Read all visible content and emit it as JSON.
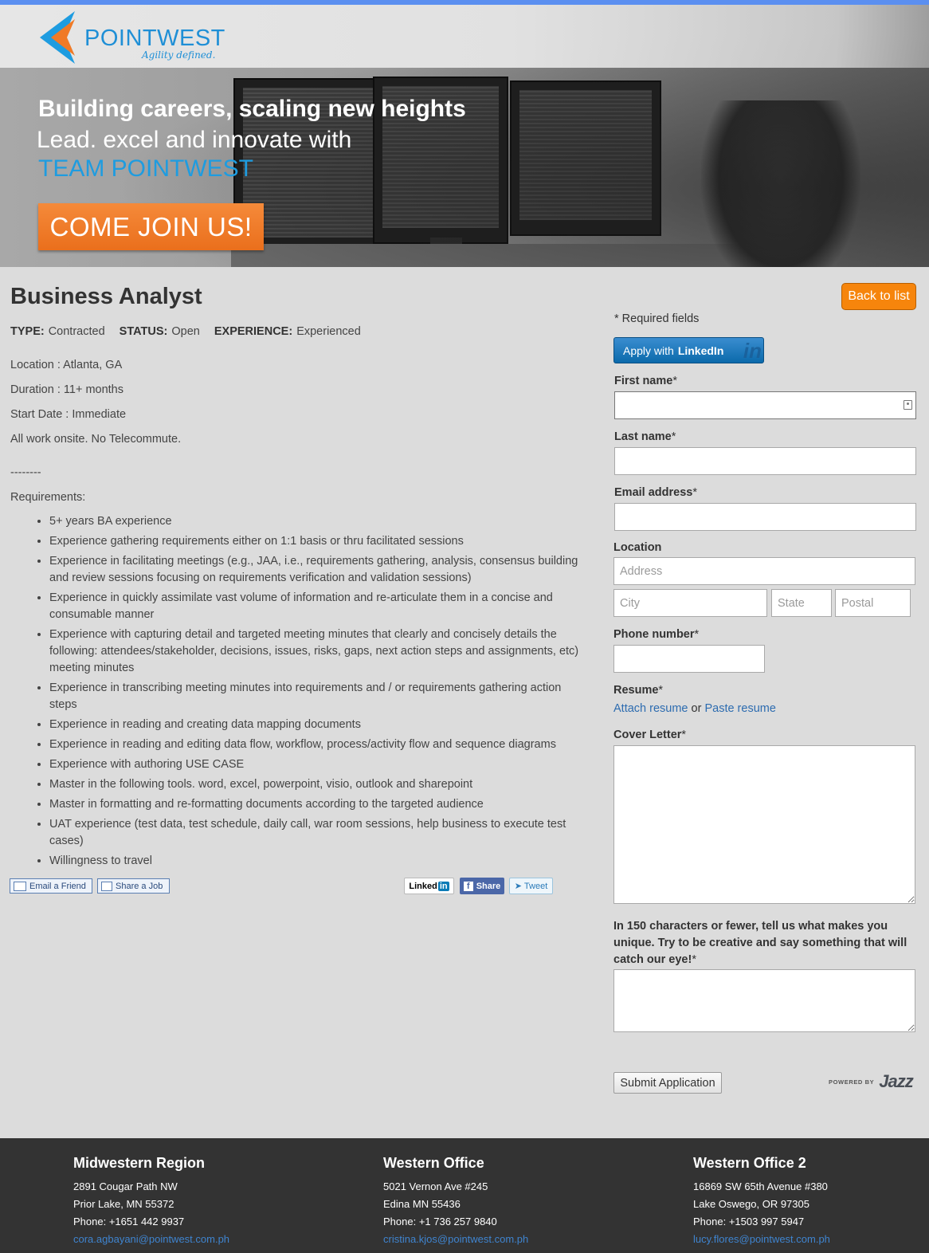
{
  "brand": {
    "name": "POINTWEST",
    "tagline": "Agility defined.",
    "colors": {
      "accent_blue": "#1e9ce0",
      "cta_orange": "#f6850c",
      "top_bar": "#5b8ff0",
      "footer_bg": "#333333"
    }
  },
  "hero": {
    "line1": "Building careers, scaling new heights",
    "line2": "Lead. excel and innovate with",
    "line3": "TEAM POINTWEST",
    "cta": "COME JOIN US!"
  },
  "job": {
    "title": "Business Analyst",
    "meta": {
      "type_label": "TYPE:",
      "type": "Contracted",
      "status_label": "STATUS:",
      "status": "Open",
      "experience_label": "EXPERIENCE:",
      "experience": "Experienced"
    },
    "details": {
      "location": "Location : Atlanta, GA",
      "duration": "Duration : 11+ months",
      "start_date": "Start Date : Immediate",
      "onsite": "All work onsite. No Telecommute.",
      "divider": "--------",
      "requirements_heading": "Requirements:"
    },
    "requirements": [
      "5+ years BA experience",
      "Experience gathering requirements either on 1:1 basis or thru facilitated sessions",
      "Experience in facilitating meetings (e.g., JAA, i.e., requirements gathering, analysis, consensus building and review sessions focusing on requirements verification and validation sessions)",
      "Experience in quickly assimilate vast volume of information and re-articulate them in a concise and consumable manner",
      "Experience with capturing detail and targeted meeting minutes that clearly and concisely details the following: attendees/stakeholder, decisions, issues, risks, gaps, next action steps and assignments, etc) meeting minutes",
      "Experience in transcribing meeting minutes into requirements and / or requirements gathering action steps",
      "Experience in reading and creating data mapping documents",
      "Experience in reading and editing data flow, workflow, process/activity flow and sequence diagrams",
      "Experience with authoring USE CASE",
      "Master in the following tools.  word, excel, powerpoint, visio, outlook and sharepoint",
      "Master in formatting and re-formatting documents according to the targeted audience",
      "UAT experience (test data, test schedule, daily call, war room sessions, help business to execute test cases)",
      "Willingness to travel"
    ]
  },
  "share": {
    "email_friend": "Email a Friend",
    "share_job": "Share a Job",
    "linkedin": "Linked",
    "linkedin_in": "in",
    "facebook": "Share",
    "twitter": "Tweet"
  },
  "form": {
    "back_to_list": "Back to list",
    "required_note": "* Required fields",
    "linkedin_apply_prefix": "Apply with ",
    "linkedin_apply_brand": "LinkedIn",
    "linkedin_badge": "in",
    "required_mark": "*",
    "first_name_label": "First name",
    "last_name_label": "Last name",
    "email_label": "Email address",
    "location_label": "Location",
    "address_placeholder": "Address",
    "city_placeholder": "City",
    "state_placeholder": "State",
    "postal_placeholder": "Postal",
    "phone_label": "Phone number",
    "resume_label": "Resume",
    "attach_resume": "Attach resume",
    "or": " or ",
    "paste_resume": "Paste resume",
    "cover_letter_label": "Cover Letter",
    "unique_label": "In 150 characters or fewer, tell us what makes you unique. Try to be creative and say something that will catch our eye!",
    "submit": "Submit Application",
    "powered_by": "POWERED BY",
    "jazz": "Jazz"
  },
  "footer": {
    "offices": [
      {
        "title": "Midwestern Region",
        "address1": "2891 Cougar Path NW",
        "address2": "Prior Lake, MN 55372",
        "phone": "Phone: +1651 442 9937",
        "email": "cora.agbayani@pointwest.com.ph"
      },
      {
        "title": "Western Office",
        "address1": "5021 Vernon Ave #245",
        "address2": "Edina MN 55436",
        "phone": "Phone: +1 736 257 9840",
        "email": "cristina.kjos@pointwest.com.ph"
      },
      {
        "title": "Western Office 2",
        "address1": "16869 SW 65th Avenue #380",
        "address2": "Lake Oswego, OR 97305",
        "phone": "Phone: +1503 997 5947",
        "email": "lucy.flores@pointwest.com.ph"
      }
    ]
  }
}
